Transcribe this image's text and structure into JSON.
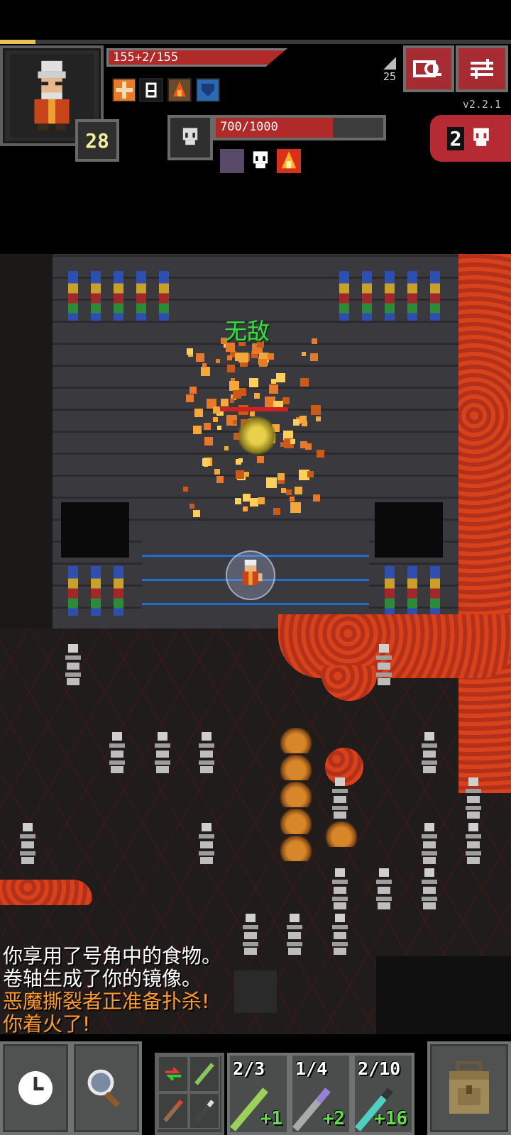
{
  "hud": {
    "xp_fraction": 0.07,
    "hp_text": "155+2/155",
    "hp_fraction": 1.0,
    "level": "28",
    "depth": "25",
    "version": "v2.2.1",
    "danger_count": "2",
    "buffs": [
      "bless-icon",
      "armor-icon",
      "fire-resist-icon",
      "shield-icon"
    ],
    "buttons": [
      "journal-button",
      "menu-button"
    ]
  },
  "boss": {
    "hp_text": "700/1000",
    "hp_fraction": 0.7,
    "debuffs": [
      "doom-icon",
      "skull-icon",
      "burning-icon"
    ]
  },
  "map": {
    "status_text": "无敌",
    "terrain": [
      "stained-glass",
      "lava",
      "bones",
      "fungus"
    ]
  },
  "log": {
    "lines": [
      {
        "text": "你享用了号角中的食物。",
        "color": "#ffffff"
      },
      {
        "text": "卷轴生成了你的镜像。",
        "color": "#ffffff"
      },
      {
        "text": "恶魔撕裂者正准备扑杀!",
        "color": "#ff9a2e"
      },
      {
        "text": "你着火了!",
        "color": "#ff9a2e"
      }
    ]
  },
  "toolbar": {
    "wait_label": "wait",
    "search_label": "search",
    "quickslots": [
      {
        "charges": "2/3",
        "upgrade": "+1",
        "color": "#9ad25a"
      },
      {
        "charges": "1/4",
        "upgrade": "+2",
        "color": "#9a7fd6"
      },
      {
        "charges": "2/10",
        "upgrade": "+16",
        "color": "#4ecfc0"
      }
    ]
  }
}
